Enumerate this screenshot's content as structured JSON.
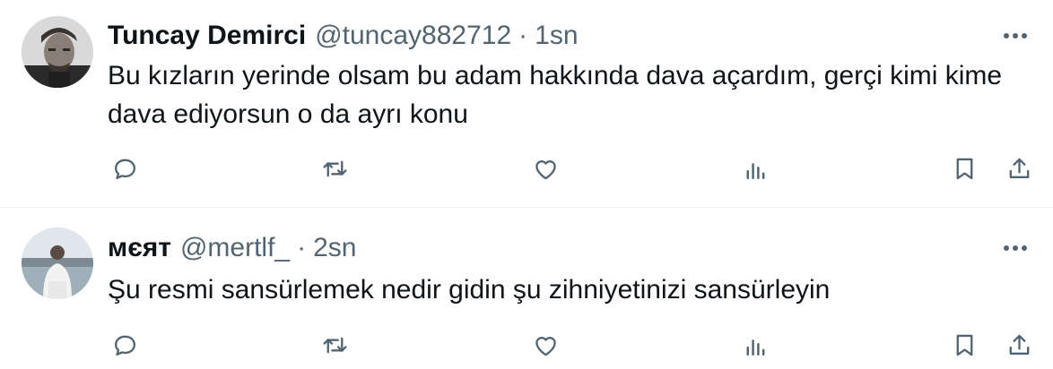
{
  "tweets": [
    {
      "name": "Tuncay Demirci",
      "handle": "@tuncay882712",
      "separator": "·",
      "time": "1sn",
      "text": "Bu kızların yerinde olsam bu adam hakkında dava açardım, gerçi kimi kime dava ediyorsun o da ayrı konu",
      "avatar": "portrait-photo"
    },
    {
      "name": "мєят",
      "handle": "@mertlf_",
      "separator": "·",
      "time": "2sn",
      "text": "Şu resmi sansürlemek nedir gidin şu zihniyetinizi sansürleyin",
      "avatar": "person-by-water-photo"
    }
  ],
  "icons": {
    "more": "more-dots-icon",
    "reply": "reply-icon",
    "retweet": "retweet-icon",
    "like": "heart-icon",
    "views": "views-icon",
    "bookmark": "bookmark-icon",
    "share": "share-icon"
  },
  "colors": {
    "text": "#0f1419",
    "muted": "#536471",
    "divider": "#eff3f4",
    "background": "#ffffff"
  }
}
